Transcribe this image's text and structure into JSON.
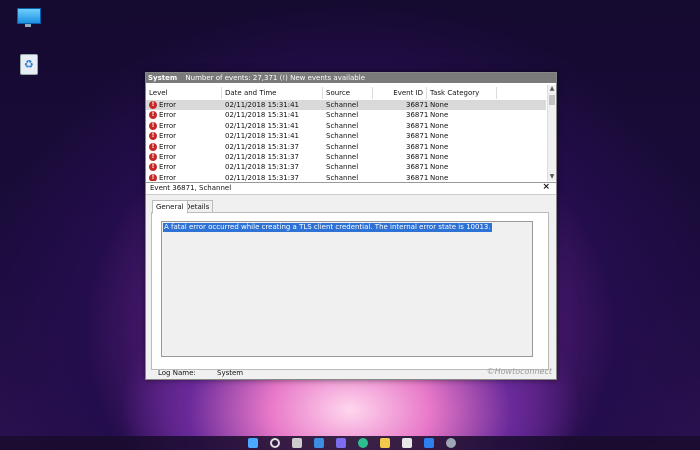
{
  "desktop": {
    "icons": [
      {
        "name": "monitor-icon"
      },
      {
        "name": "recycle-bin-icon"
      }
    ]
  },
  "event_viewer": {
    "log_name": "System",
    "summary": "Number of events: 27,371 (!) New events available",
    "columns": [
      "Level",
      "Date and Time",
      "Source",
      "Event ID",
      "Task Category"
    ],
    "rows": [
      {
        "level": "Error",
        "datetime": "02/11/2018 15:31:41",
        "source": "Schannel",
        "event_id": "36871",
        "task": "None"
      },
      {
        "level": "Error",
        "datetime": "02/11/2018 15:31:41",
        "source": "Schannel",
        "event_id": "36871",
        "task": "None"
      },
      {
        "level": "Error",
        "datetime": "02/11/2018 15:31:41",
        "source": "Schannel",
        "event_id": "36871",
        "task": "None"
      },
      {
        "level": "Error",
        "datetime": "02/11/2018 15:31:41",
        "source": "Schannel",
        "event_id": "36871",
        "task": "None"
      },
      {
        "level": "Error",
        "datetime": "02/11/2018 15:31:37",
        "source": "Schannel",
        "event_id": "36871",
        "task": "None"
      },
      {
        "level": "Error",
        "datetime": "02/11/2018 15:31:37",
        "source": "Schannel",
        "event_id": "36871",
        "task": "None"
      },
      {
        "level": "Error",
        "datetime": "02/11/2018 15:31:37",
        "source": "Schannel",
        "event_id": "36871",
        "task": "None"
      },
      {
        "level": "Error",
        "datetime": "02/11/2018 15:31:37",
        "source": "Schannel",
        "event_id": "36871",
        "task": "None"
      }
    ],
    "detail": {
      "title": "Event 36871, Schannel",
      "close": "×",
      "tabs": [
        "General",
        "Details"
      ],
      "active_tab": "General",
      "message": "A fatal error occurred while creating a TLS client credential. The internal error state is 10013.",
      "log_name_label": "Log Name:",
      "log_name_value": "System",
      "watermark": "©Howtoconnect"
    }
  },
  "taskbar": {
    "icons": [
      "windows-start-icon",
      "search-icon",
      "task-view-icon",
      "widgets-icon",
      "chat-icon",
      "edge-icon",
      "file-explorer-icon",
      "store-icon",
      "mail-icon",
      "settings-icon"
    ]
  },
  "colors": {
    "selection": "#2f72d6",
    "error": "#c62828",
    "header": "#7a7a7a"
  }
}
